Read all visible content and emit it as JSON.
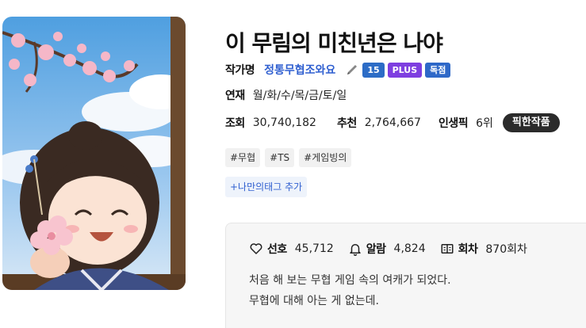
{
  "novel": {
    "title": "이 무림의 미친년은 나야",
    "author_label": "작가명",
    "author_name": "정통무협조와요",
    "author_icon": "pen-icon",
    "author_badge_count": "15",
    "badge_plus": "PLUS",
    "badge_exclusive": "독점",
    "schedule_label": "연재",
    "schedule_value": "월/화/수/목/금/토/일",
    "views_label": "조회",
    "views_value": "30,740,182",
    "recommend_label": "추천",
    "recommend_value": "2,764,667",
    "life_pick_label": "인생픽",
    "life_pick_value": "6위",
    "pick_button": "픽한작품"
  },
  "tags": [
    "#무협",
    "#TS",
    "#게임빙의"
  ],
  "add_tag_label": "+나만의태그 추가",
  "panel": {
    "likes_icon": "heart-icon",
    "likes_label": "선호",
    "likes_value": "45,712",
    "alarm_icon": "bell-icon",
    "alarm_label": "알람",
    "alarm_value": "4,824",
    "episodes_icon": "book-icon",
    "episodes_label": "회차",
    "episodes_value": "870회차",
    "description": [
      "처음 해 보는 무협 게임 속의 여캐가 되었다.",
      "무협에 대해 아는 게 없는데."
    ]
  },
  "colors": {
    "author_link": "#2f5fd0",
    "badge_count": "#2c6cc6",
    "badge_plus": "#7e3ee0",
    "badge_exclusive": "#2e68c8",
    "pick_button_bg": "#2b2b2b"
  }
}
